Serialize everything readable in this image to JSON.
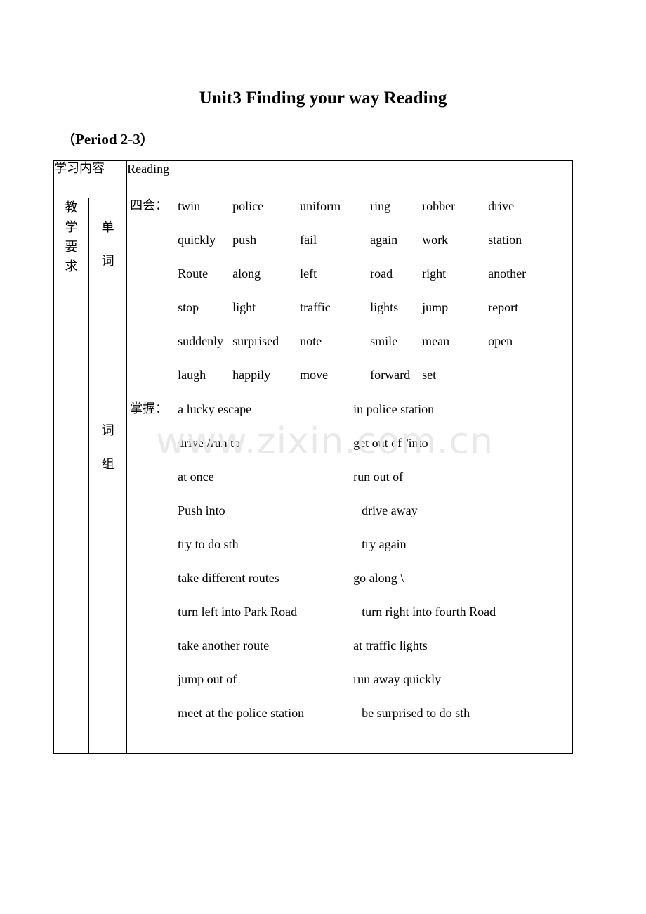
{
  "document": {
    "title": "Unit3 Finding your way Reading",
    "subtitle_open_paren": "（",
    "subtitle_text": "Period 2-3",
    "subtitle_close_paren": "）",
    "watermark": "www.zixin.com.cn"
  },
  "table": {
    "study_content_label": "学习内容",
    "study_content_value": "Reading",
    "requirement_label_chars": [
      "教",
      "学",
      "要",
      "求"
    ],
    "words_section": {
      "label_chars": [
        "单",
        "词"
      ],
      "prefix": "四会：",
      "rows": [
        [
          "twin",
          "police",
          "uniform",
          "ring",
          "robber",
          "drive"
        ],
        [
          "quickly",
          "push",
          "fail",
          "again",
          "work",
          "station"
        ],
        [
          "Route",
          "along",
          "left",
          "road",
          "right",
          "another"
        ],
        [
          "stop",
          "light",
          "traffic",
          "lights",
          "jump",
          "report"
        ],
        [
          "suddenly",
          "surprised",
          "note",
          "smile",
          "mean",
          "open"
        ],
        [
          "laugh",
          "happily",
          "move",
          "forward",
          "set",
          ""
        ]
      ]
    },
    "phrases_section": {
      "label_chars": [
        "词",
        "组"
      ],
      "prefix": "掌握：",
      "rows": [
        {
          "left": "a lucky escape",
          "right": "in police station",
          "right_indent": false
        },
        {
          "left": "drive /run to",
          "right": "get out of /into",
          "right_indent": false
        },
        {
          "left": "at once",
          "right": "run out of",
          "right_indent": false
        },
        {
          "left": "Push into",
          "right": "drive away",
          "right_indent": true
        },
        {
          "left": "try to do sth",
          "right": "try again",
          "right_indent": true
        },
        {
          "left": "take different routes",
          "right": "go along \\",
          "right_indent": false
        },
        {
          "left": "turn left into Park Road",
          "right": "turn right into fourth Road",
          "right_indent": true
        },
        {
          "left": "take another route",
          "right": "at traffic lights",
          "right_indent": false
        },
        {
          "left": "jump out of",
          "right": "run away quickly",
          "right_indent": false
        },
        {
          "left": "meet at the police station",
          "right": "be surprised to do sth",
          "right_indent": true
        }
      ]
    }
  }
}
